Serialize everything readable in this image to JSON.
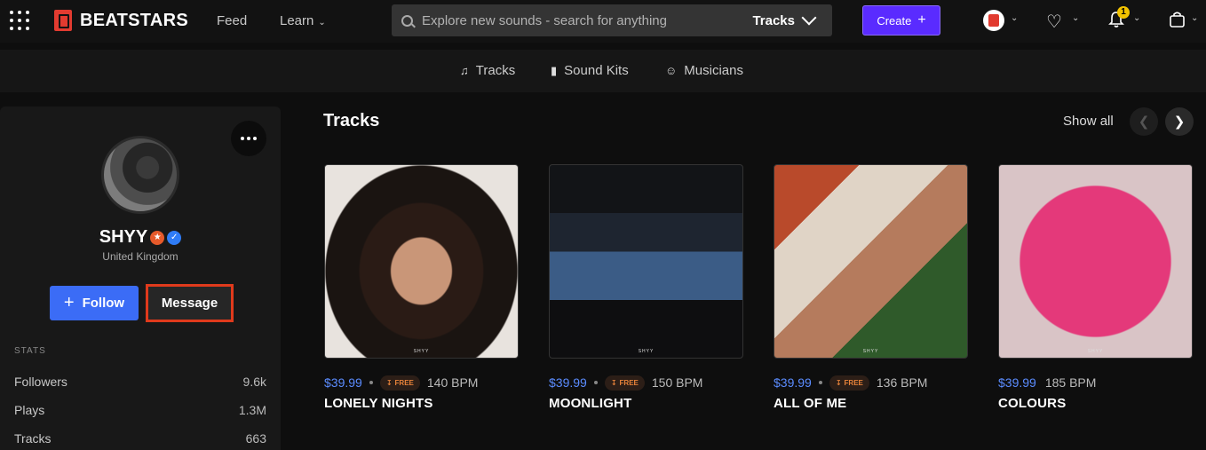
{
  "brand": {
    "name": "BEATSTARS",
    "color": "#e23b30"
  },
  "topnav": {
    "feed": "Feed",
    "learn": "Learn",
    "search_placeholder": "Explore new sounds - search for anything",
    "search_scope": "Tracks",
    "create": "Create",
    "notification_count": "1"
  },
  "subnav": {
    "items": [
      {
        "label": "Tracks",
        "icon": "music-note-icon"
      },
      {
        "label": "Sound Kits",
        "icon": "waveform-icon"
      },
      {
        "label": "Musicians",
        "icon": "user-icon"
      }
    ]
  },
  "profile": {
    "name": "SHYY",
    "location": "United Kingdom",
    "follow": "Follow",
    "message": "Message",
    "stats_title": "STATS",
    "stats": [
      {
        "label": "Followers",
        "value": "9.6k"
      },
      {
        "label": "Plays",
        "value": "1.3M"
      },
      {
        "label": "Tracks",
        "value": "663"
      }
    ]
  },
  "tracks_section": {
    "title": "Tracks",
    "show_all": "Show all",
    "watermark": "SHYY",
    "free_label": "FREE",
    "items": [
      {
        "title": "LONELY NIGHTS",
        "price": "$39.99",
        "free": true,
        "bpm": "140 BPM"
      },
      {
        "title": "MOONLIGHT",
        "price": "$39.99",
        "free": true,
        "bpm": "150 BPM"
      },
      {
        "title": "ALL OF ME",
        "price": "$39.99",
        "free": true,
        "bpm": "136 BPM"
      },
      {
        "title": "COLOURS",
        "price": "$39.99",
        "free": false,
        "bpm": "185 BPM"
      }
    ]
  },
  "colors": {
    "accent": "#5a2bff",
    "follow": "#3b6cf6",
    "price": "#5b8cff",
    "free": "#e8833a",
    "highlight": "#e03a1c"
  }
}
